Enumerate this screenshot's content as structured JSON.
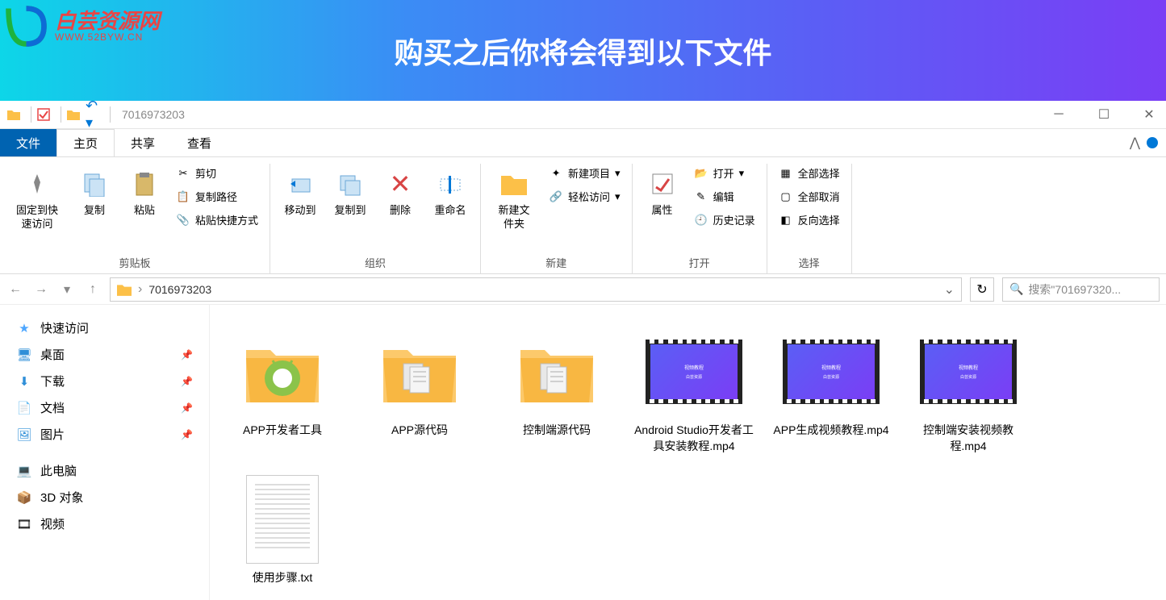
{
  "banner": {
    "logo_main": "白芸资源网",
    "logo_sub": "WWW.52BYW.CN",
    "title": "购买之后你将会得到以下文件"
  },
  "titlebar": {
    "folder_name": "7016973203"
  },
  "tabs": {
    "file": "文件",
    "home": "主页",
    "share": "共享",
    "view": "查看"
  },
  "ribbon": {
    "clipboard": {
      "pin": "固定到快速访问",
      "copy": "复制",
      "paste": "粘贴",
      "cut": "剪切",
      "copy_path": "复制路径",
      "paste_shortcut": "粘贴快捷方式",
      "label": "剪贴板"
    },
    "organize": {
      "move_to": "移动到",
      "copy_to": "复制到",
      "delete": "删除",
      "rename": "重命名",
      "label": "组织"
    },
    "new": {
      "new_folder": "新建文件夹",
      "new_item": "新建项目",
      "easy_access": "轻松访问",
      "label": "新建"
    },
    "open": {
      "properties": "属性",
      "open": "打开",
      "edit": "编辑",
      "history": "历史记录",
      "label": "打开"
    },
    "select": {
      "select_all": "全部选择",
      "select_none": "全部取消",
      "invert": "反向选择",
      "label": "选择"
    }
  },
  "addrbar": {
    "path": "7016973203",
    "search_placeholder": "搜索\"701697320..."
  },
  "sidebar": {
    "quick_access": "快速访问",
    "desktop": "桌面",
    "downloads": "下载",
    "documents": "文档",
    "pictures": "图片",
    "this_pc": "此电脑",
    "objects_3d": "3D 对象",
    "videos": "视频"
  },
  "files": [
    {
      "name": "APP开发者工具",
      "type": "folder-android"
    },
    {
      "name": "APP源代码",
      "type": "folder-docs"
    },
    {
      "name": "控制端源代码",
      "type": "folder-docs"
    },
    {
      "name": "Android Studio开发者工具安装教程.mp4",
      "type": "video"
    },
    {
      "name": "APP生成视频教程.mp4",
      "type": "video"
    },
    {
      "name": "控制端安装视频教程.mp4",
      "type": "video"
    },
    {
      "name": "使用步骤.txt",
      "type": "txt"
    }
  ]
}
